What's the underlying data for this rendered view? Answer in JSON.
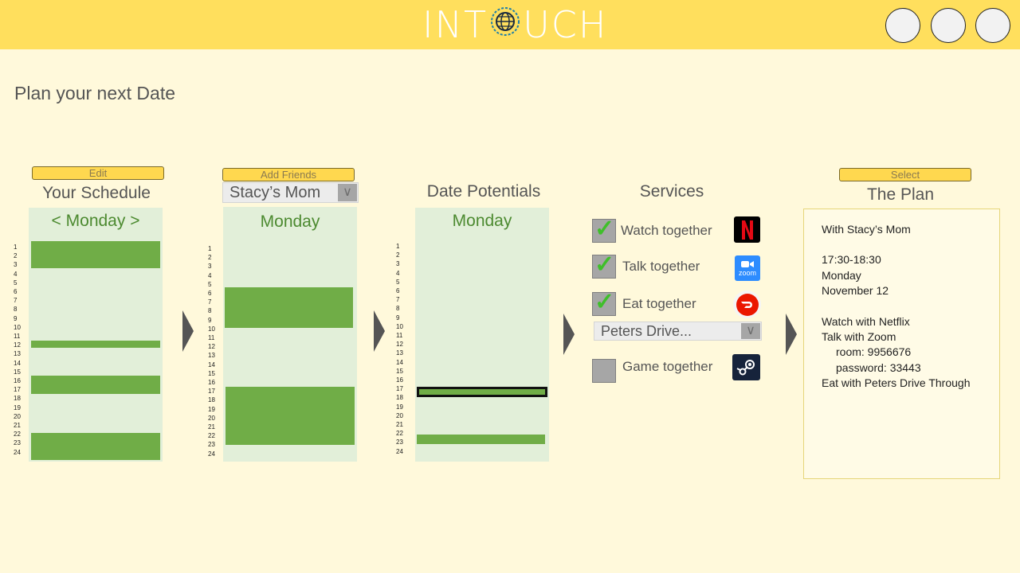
{
  "header": {
    "logo_left": "IN",
    "logo_mid": "T",
    "logo_right": "UCH",
    "icons": [
      "globe-icon",
      "avatar-1",
      "avatar-2",
      "avatar-3"
    ]
  },
  "page_title": "Plan your next Date",
  "schedule": {
    "edit_label": "Edit",
    "title": "Your Schedule",
    "day_label": "<  Monday  >"
  },
  "friends": {
    "add_label": "Add Friends",
    "selected_friend": "Stacy’s Mom",
    "day_label": "Monday"
  },
  "potentials": {
    "title": "Date Potentials",
    "day_label": "Monday"
  },
  "hours": [
    "1",
    "2",
    "3",
    "4",
    "5",
    "6",
    "7",
    "8",
    "9",
    "10",
    "11",
    "12",
    "13",
    "14",
    "15",
    "16",
    "17",
    "18",
    "19",
    "20",
    "21",
    "22",
    "23",
    "24"
  ],
  "services": {
    "title": "Services",
    "items": [
      {
        "label": "Watch together",
        "checked": true,
        "icon": "netflix-icon"
      },
      {
        "label": "Talk together",
        "checked": true,
        "icon": "zoom-icon"
      },
      {
        "label": "Eat together",
        "checked": true,
        "icon": "doordash-icon"
      },
      {
        "label": "Game together",
        "checked": false,
        "icon": "steam-icon"
      }
    ],
    "eat_option": "Peters Drive...",
    "zoom_icon_text": "zoom"
  },
  "plan": {
    "select_label": "Select",
    "title": "The Plan",
    "with": "With Stacy’s Mom",
    "time": "17:30-18:30",
    "day": "Monday",
    "date": "November  12",
    "watch": "Watch with  Netflix",
    "talk": "Talk with Zoom",
    "room": "room:  9956676",
    "password": "password: 33443",
    "eat": "Eat with Peters Drive Through"
  },
  "colors": {
    "header": "#ffdf5d",
    "background": "#fff9db",
    "panel": "#e2efd9",
    "busy_block": "#70ad47"
  }
}
